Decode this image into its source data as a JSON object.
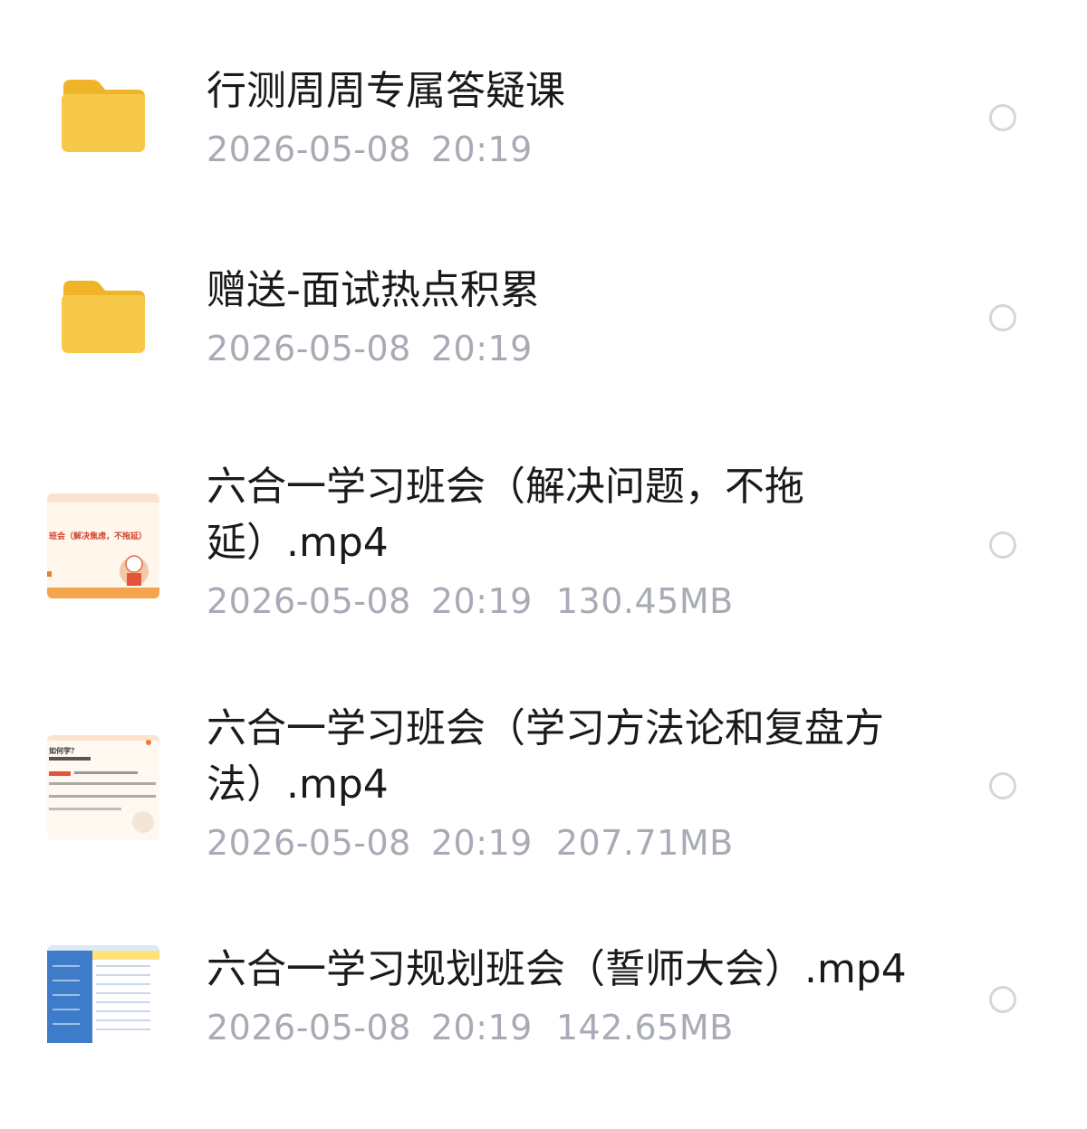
{
  "files": [
    {
      "kind": "folder",
      "icon": "folder-icon",
      "name": "行测周周专属答疑课",
      "date": "2026-05-08",
      "time": "20:19",
      "size": ""
    },
    {
      "kind": "folder",
      "icon": "folder-icon",
      "name": "赠送-面试热点积累",
      "date": "2026-05-08",
      "time": "20:19",
      "size": ""
    },
    {
      "kind": "video",
      "icon": "video-thumbnail",
      "name": "六合一学习班会（解决问题，不拖\n延）.mp4",
      "thumb_text": "班会（解决焦虑，不拖延）",
      "date": "2026-05-08",
      "time": "20:19",
      "size": "130.45MB"
    },
    {
      "kind": "video",
      "icon": "video-thumbnail",
      "name": "六合一学习班会（学习方法论和复盘方\n法）.mp4",
      "thumb_text": "如何学？",
      "date": "2026-05-08",
      "time": "20:19",
      "size": "207.71MB"
    },
    {
      "kind": "video",
      "icon": "video-thumbnail",
      "name": "六合一学习规划班会（誓师大会）.mp4",
      "thumb_text": "",
      "date": "2026-05-08",
      "time": "20:19",
      "size": "142.65MB"
    }
  ],
  "colors": {
    "folder": "#F7C94A",
    "folder_dark": "#F0B429",
    "meta_text": "#A8ABB5",
    "radio_border": "#D4D6DA"
  }
}
